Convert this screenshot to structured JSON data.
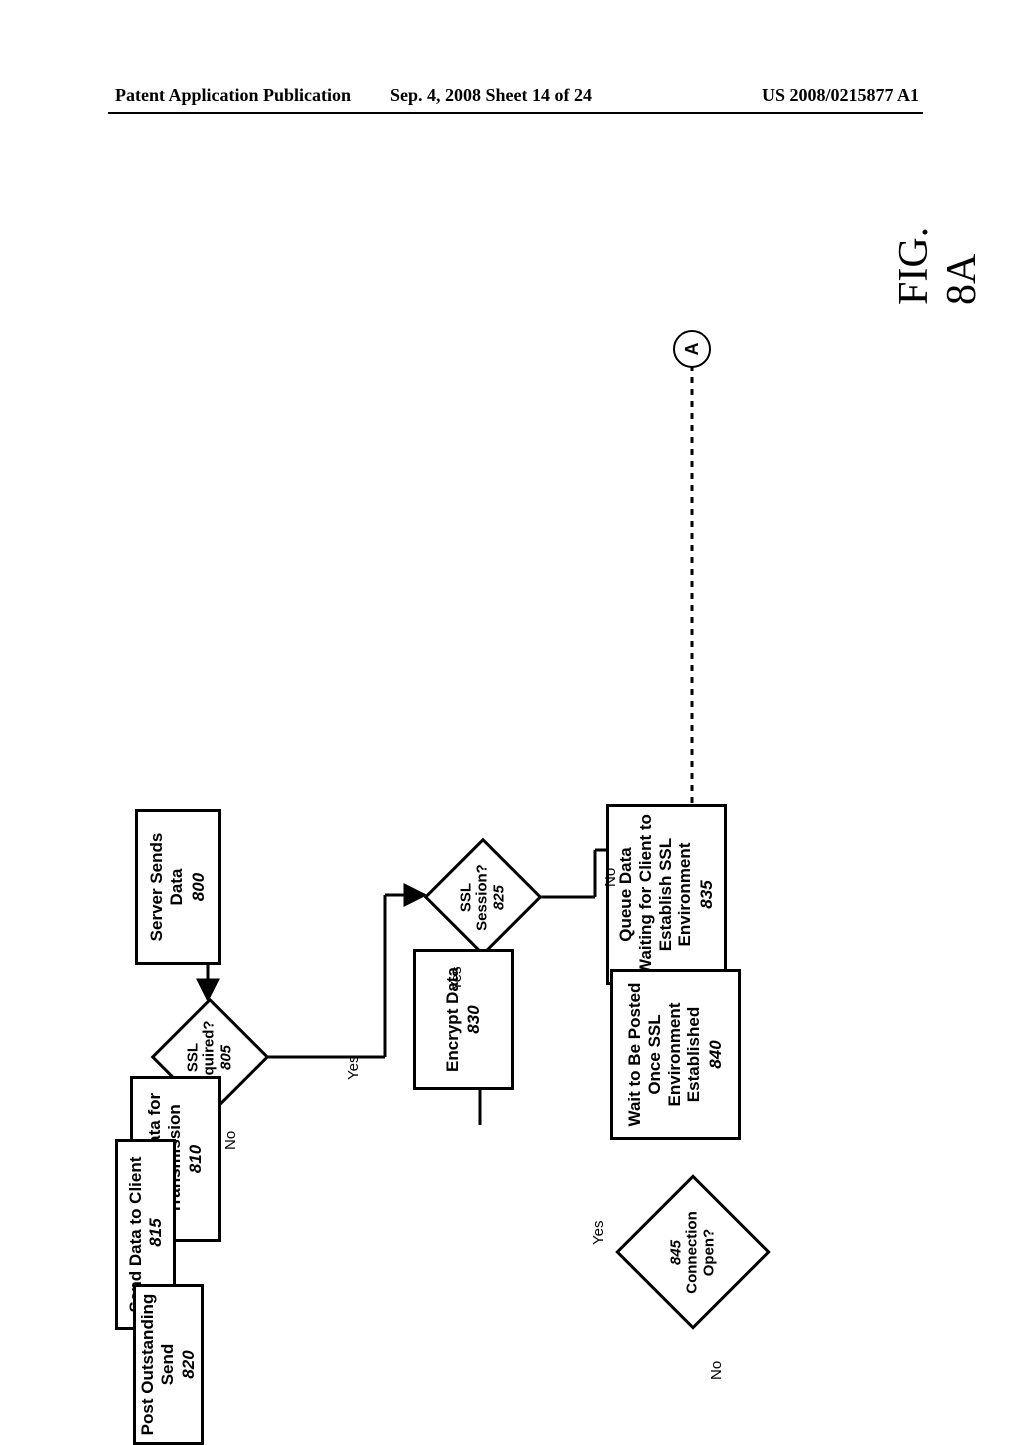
{
  "header": {
    "left": "Patent Application Publication",
    "center": "Sep. 4, 2008  Sheet 14 of 24",
    "right": "US 2008/0215877 A1"
  },
  "figure_title": "FIG. 8A",
  "nodes": {
    "n800": {
      "label": "Server Sends\nData",
      "num": "800"
    },
    "n805": {
      "label": "SSL\nRequired?",
      "num": "805"
    },
    "n810": {
      "label": "Prepare Data for\nTransmission",
      "num": "810"
    },
    "n815": {
      "label": "Send Data to Client",
      "num": "815"
    },
    "n820": {
      "label": "Post Outstanding\nSend",
      "num": "820"
    },
    "n825": {
      "label": "SSL\nSession?",
      "num": "825"
    },
    "n830": {
      "label": "Encrypt Data",
      "num": "830"
    },
    "n835": {
      "label": "Queue Data\nWaiting for Client to\nEstablish SSL\nEnvironment",
      "num": "835"
    },
    "n840": {
      "label": "Wait to Be Posted\nOnce SSL\nEnvironment\nEstablished",
      "num": "840"
    },
    "n845": {
      "label": "Connection\nOpen?",
      "num": "845"
    },
    "connA": "A"
  },
  "branches": {
    "n805_no": "No",
    "n805_yes": "Yes",
    "n825_yes": "Yes",
    "n825_no": "No",
    "n845_yes": "Yes",
    "n845_no": "No"
  }
}
